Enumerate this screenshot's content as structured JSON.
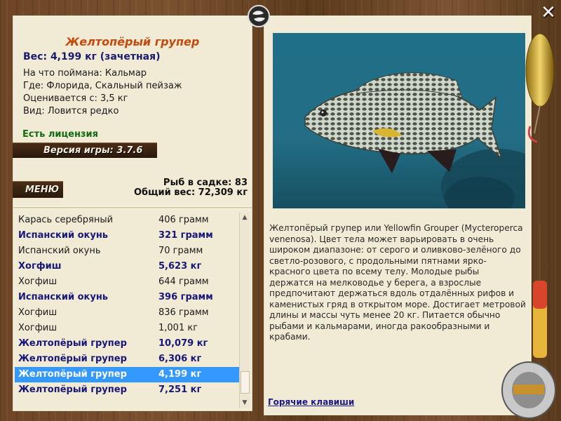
{
  "fish": {
    "title": "Желтопёрый групер",
    "weight": "Вес: 4,199 кг (зачетная)",
    "bait": "На что поймана: Кальмар",
    "place": "Где: Флорида, Скальный пейзаж",
    "value": "Оценивается с: 3,5 кг",
    "kind": "Вид: Ловится редко",
    "license": "Есть лицензия"
  },
  "version": "Версия игры: 3.7.6",
  "menu": "МЕНЮ",
  "stats": {
    "in_keepnet": "Рыб в садке: 83",
    "total_weight": "Общий вес: 72,309 кг"
  },
  "catch_list": [
    {
      "name": "Карась серебряный",
      "weight": "406 грамм",
      "bold": false,
      "selected": false
    },
    {
      "name": "Испанский окунь",
      "weight": "321 грамм",
      "bold": true,
      "selected": false
    },
    {
      "name": "Испанский окунь",
      "weight": "70 грамм",
      "bold": false,
      "selected": false
    },
    {
      "name": "Хогфиш",
      "weight": "5,623 кг",
      "bold": true,
      "selected": false
    },
    {
      "name": "Хогфиш",
      "weight": "644 грамм",
      "bold": false,
      "selected": false
    },
    {
      "name": "Испанский окунь",
      "weight": "396 грамм",
      "bold": true,
      "selected": false
    },
    {
      "name": "Хогфиш",
      "weight": "836 грамм",
      "bold": false,
      "selected": false
    },
    {
      "name": "Хогфиш",
      "weight": "1,001 кг",
      "bold": false,
      "selected": false
    },
    {
      "name": "Желтопёрый групер",
      "weight": "10,079 кг",
      "bold": true,
      "selected": false
    },
    {
      "name": "Желтопёрый групер",
      "weight": "6,306 кг",
      "bold": true,
      "selected": false
    },
    {
      "name": "Желтопёрый групер",
      "weight": "4,199 кг",
      "bold": true,
      "selected": true
    },
    {
      "name": "Желтопёрый групер",
      "weight": "7,251 кг",
      "bold": true,
      "selected": false
    }
  ],
  "description": "Желтопёрый групер или Yellowfin Grouper (Mycteroperca venenosa). Цвет тела может варьировать в очень широком диапазоне: от серого и оливково-зелёного до светло-розового, с продольными пятнами ярко-красного цвета по всему телу. Молодые рыбы держатся на мелководье у берега, а взрослые предпочитают держаться вдоль отдалённых рифов и каменистых гряд в открытом море. Достигает метровой длины и массы чуть менее 20 кг. Питается обычно рыбами и кальмарами, иногда ракообразными и крабами.",
  "hotkeys": "Горячие клавиши",
  "colors": {
    "title": "#c14a0c",
    "weight": "#1a1a6e",
    "license": "#136a12",
    "selection": "#3399ff",
    "panel": "#f1ead4"
  },
  "icons": {
    "close": "close-icon",
    "logo": "fish-logo-icon",
    "scroll_up": "chevron-up-icon",
    "scroll_down": "chevron-down-icon"
  }
}
